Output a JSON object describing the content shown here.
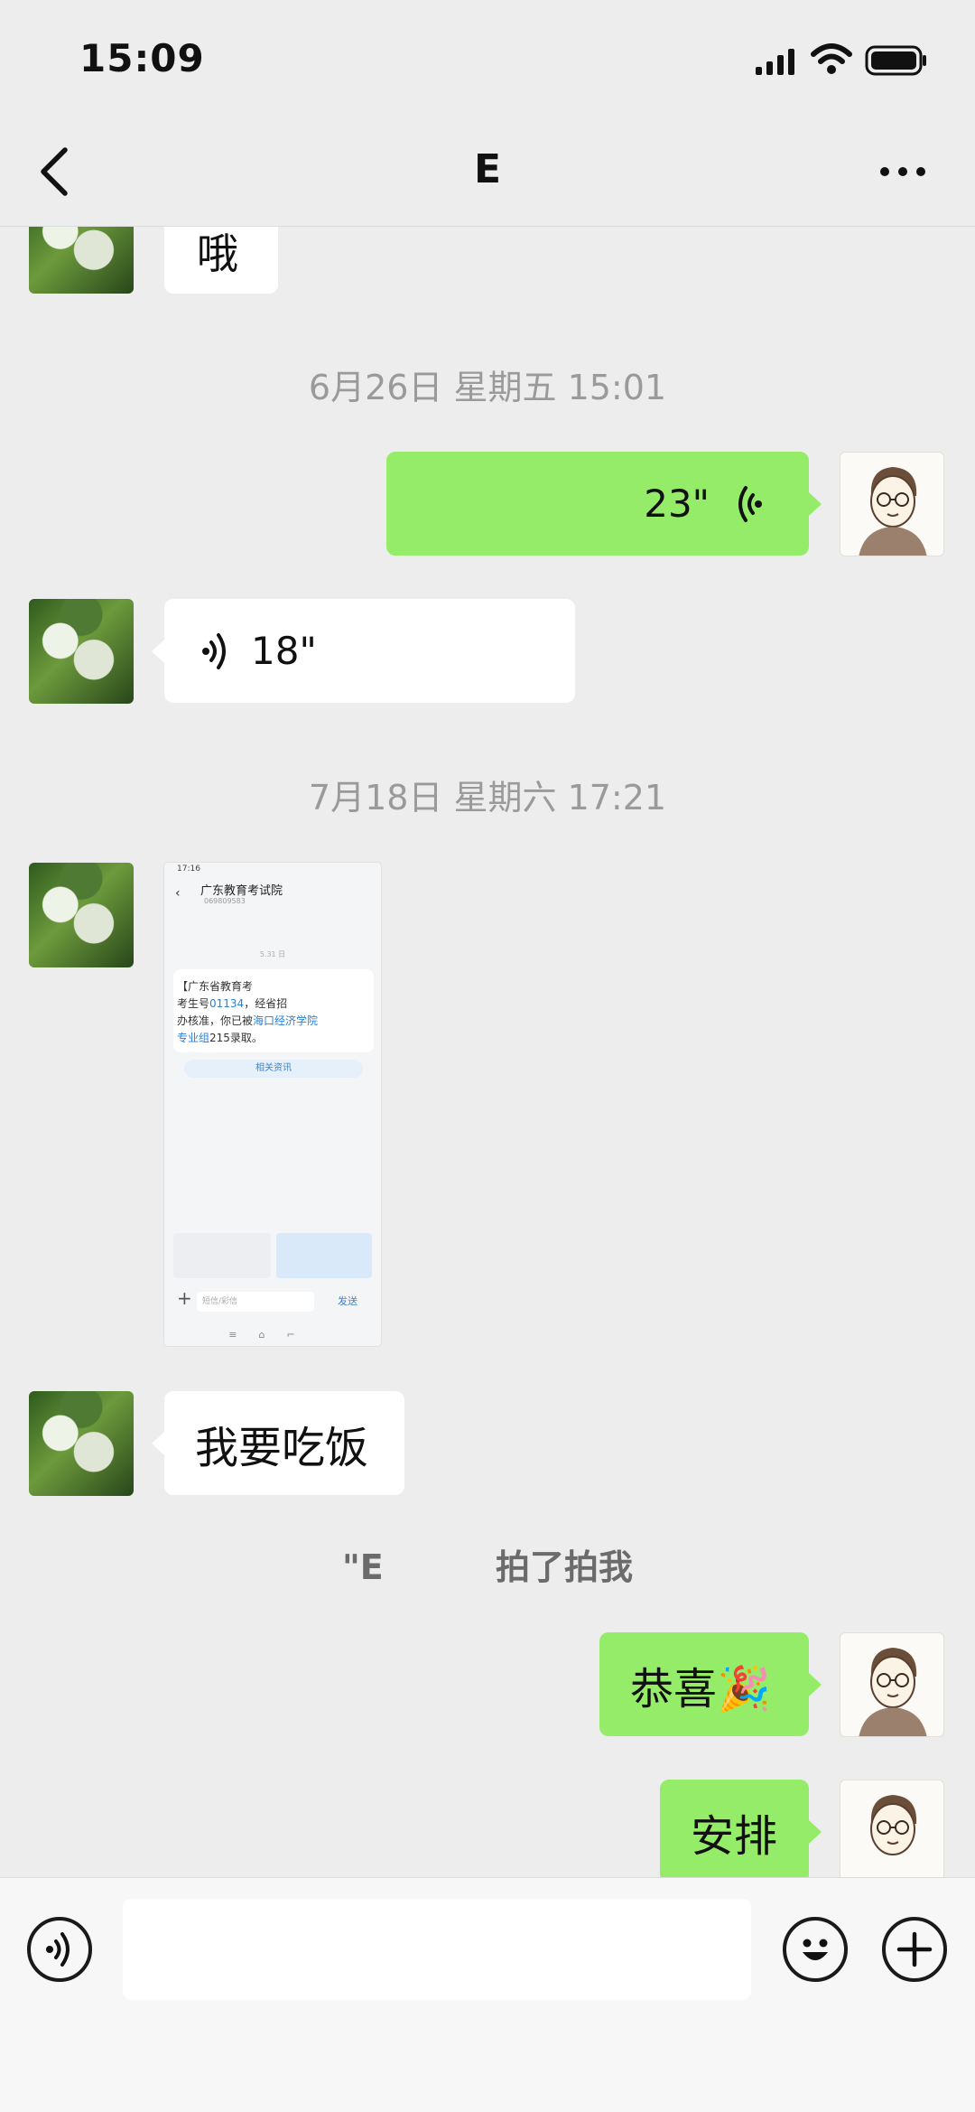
{
  "status_bar": {
    "time": "15:09"
  },
  "nav": {
    "title": "E"
  },
  "messages": {
    "m1_text": "哦",
    "ts1": "6月26日 星期五 15:01",
    "voice_out_duration": "23\"",
    "voice_in_duration": "18\"",
    "ts2": "7月18日 星期六 17:21",
    "m_eat": "我要吃饭",
    "pat_name": "\"E",
    "pat_action": "拍了拍我",
    "congrats": "恭喜🎉",
    "arrange": "安排"
  },
  "shared_image": {
    "status_time": "17:16",
    "title": "广东教育考试院",
    "subtitle": "069809583",
    "date_small": "5.31 日",
    "sms_line1": "【广东省教育考",
    "sms_line2a": "考生号",
    "sms_line2b": "01134",
    "sms_line2c": "，经省招",
    "sms_line3a": "办核准，你已被",
    "sms_line3b": "海口经济学院",
    "sms_line4a": "专业组",
    "sms_line4b": "215录取。",
    "button": "相关资讯",
    "input_placeholder": "短信/彩信",
    "send": "发送"
  },
  "colors": {
    "background": "#ededed",
    "bubble_out": "#95ec69",
    "bubble_in": "#ffffff",
    "timestamp": "#9a9a9a"
  },
  "icons": {
    "back": "chevron-left-icon",
    "more": "more-dots-icon",
    "voice_mode": "voice-icon",
    "emoji": "emoji-icon",
    "plus": "plus-icon"
  }
}
